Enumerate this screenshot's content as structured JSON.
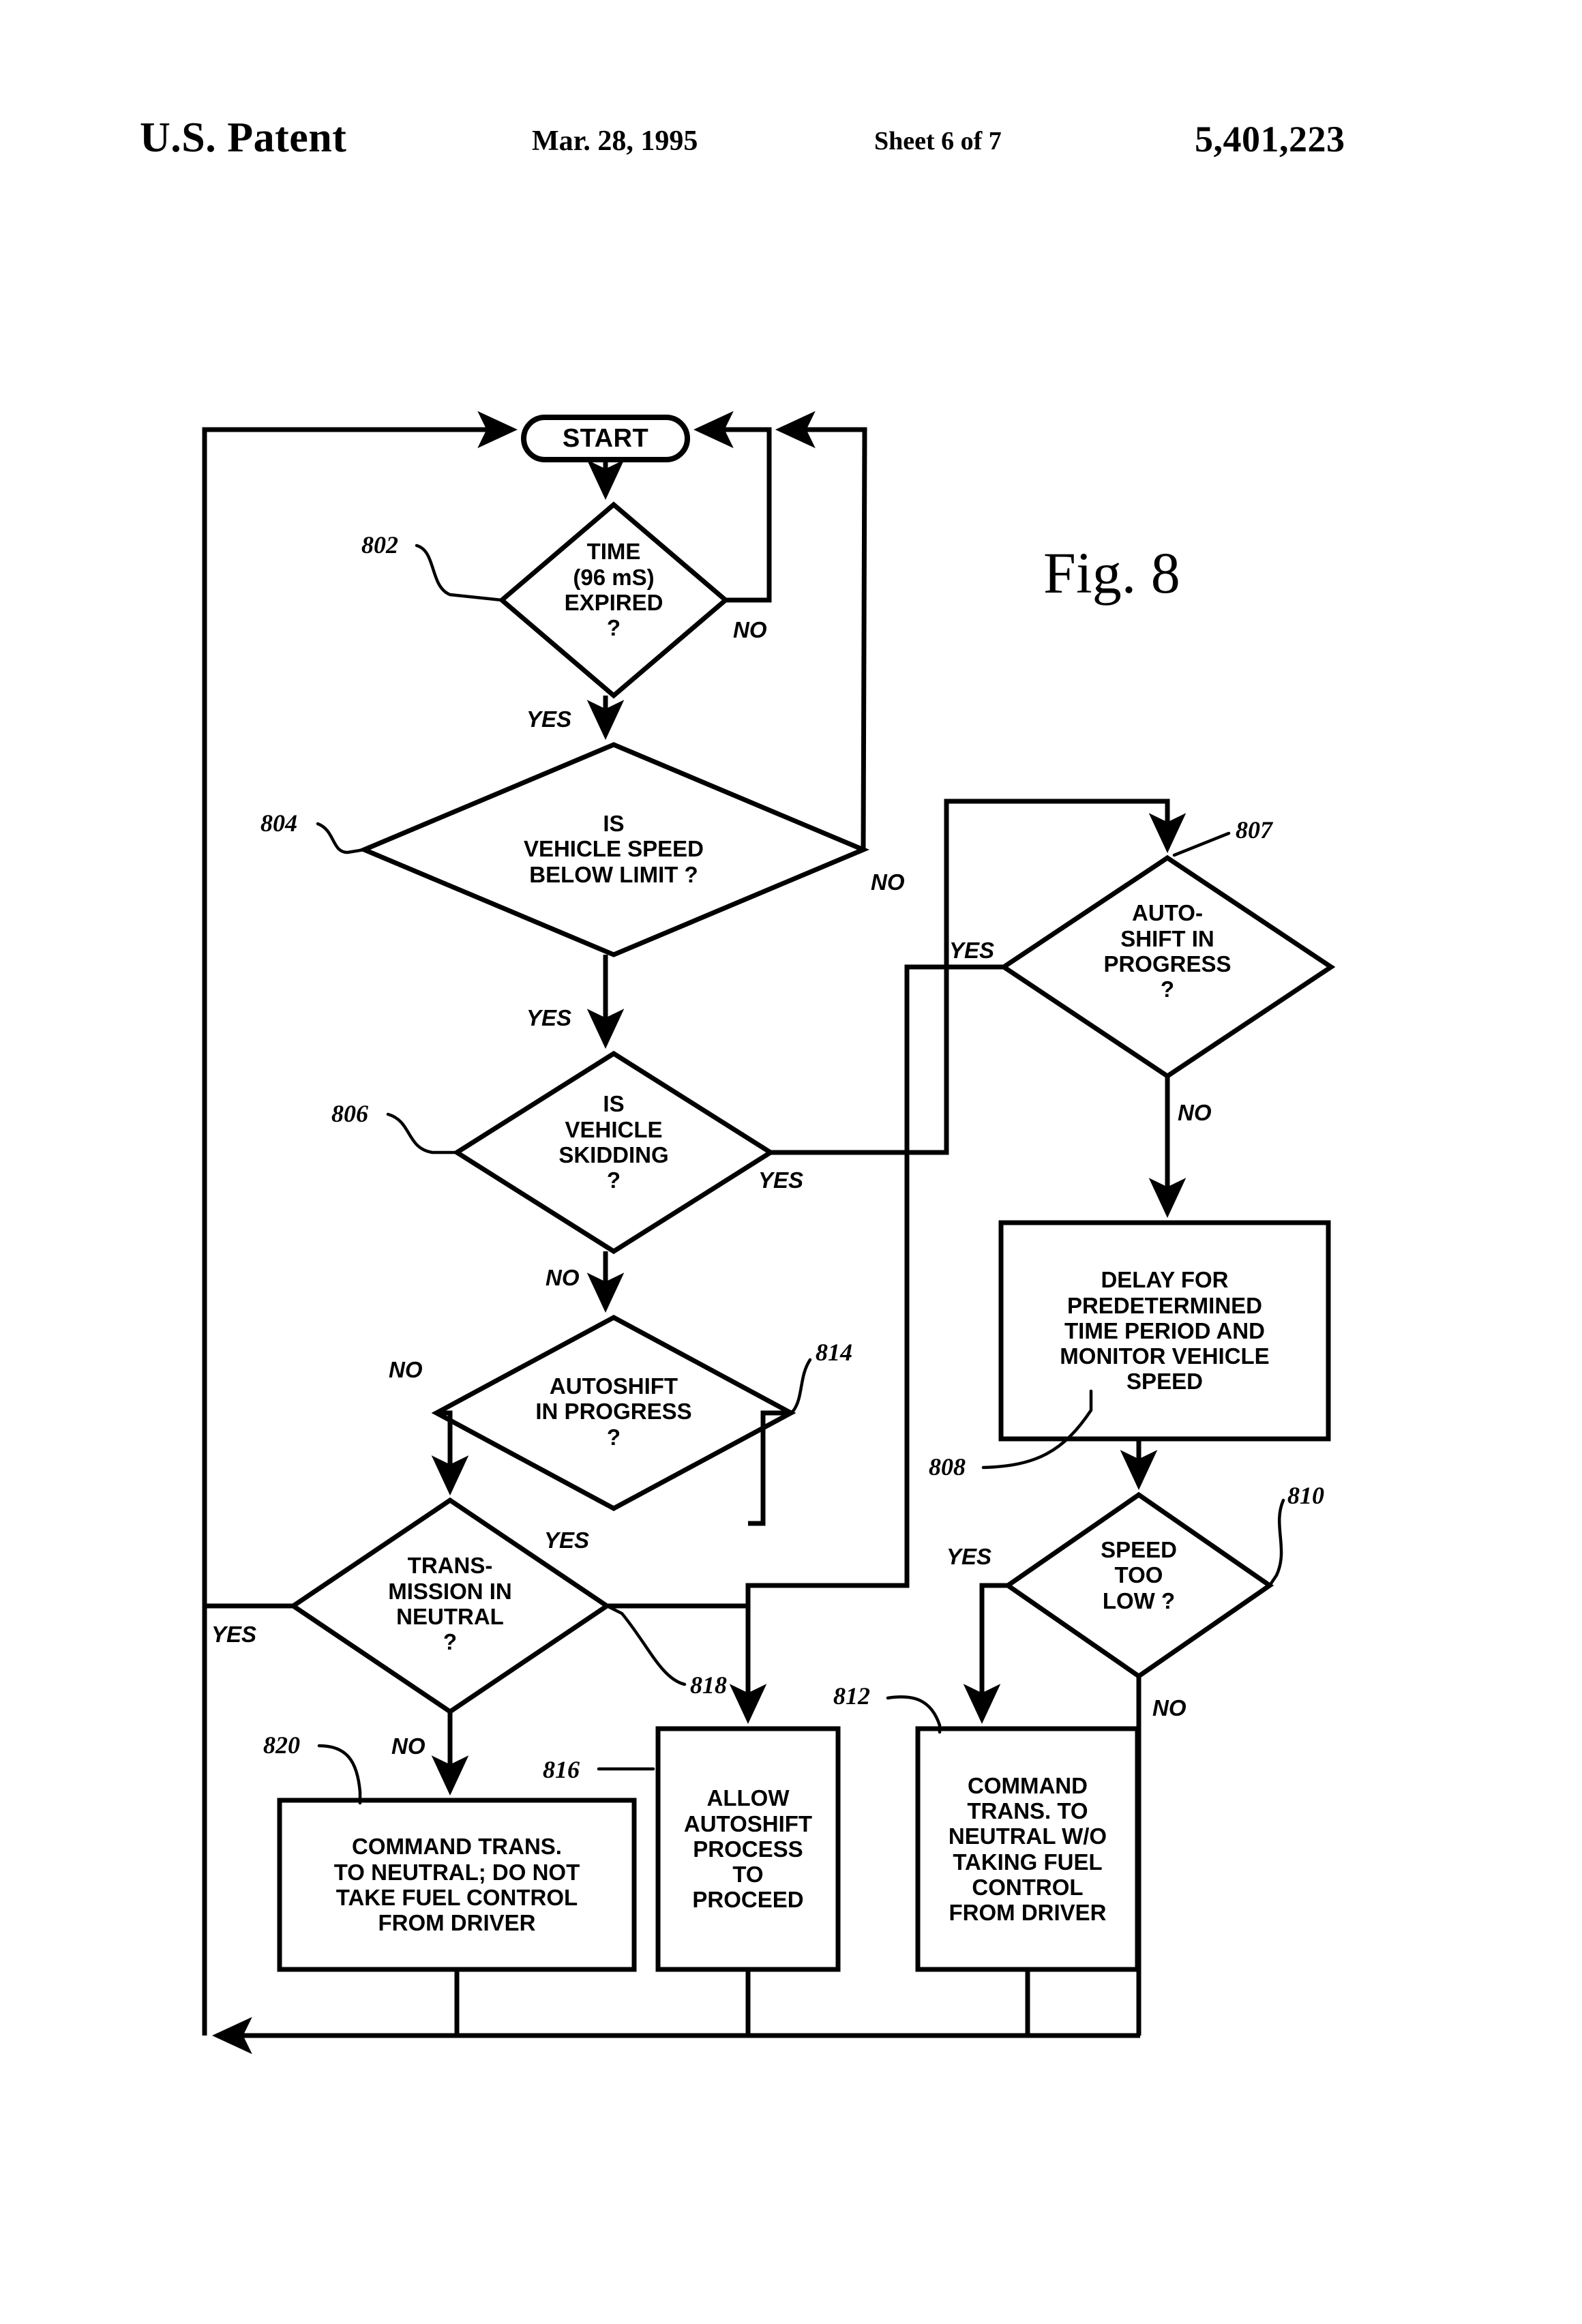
{
  "header": {
    "office": "U.S. Patent",
    "date": "Mar. 28, 1995",
    "sheet": "Sheet 6 of 7",
    "patent_number": "5,401,223"
  },
  "figure": {
    "label": "Fig. 8"
  },
  "nodes": {
    "start": {
      "ref": "",
      "text": "START",
      "shape": "terminator"
    },
    "n802": {
      "ref": "802",
      "text": "TIME\n(96 mS)\nEXPIRED\n?",
      "shape": "decision"
    },
    "n804": {
      "ref": "804",
      "text": "IS\nVEHICLE SPEED\nBELOW LIMIT  ?",
      "shape": "decision"
    },
    "n806": {
      "ref": "806",
      "text": "IS\nVEHICLE\nSKIDDING\n?",
      "shape": "decision"
    },
    "n807": {
      "ref": "807",
      "text": "AUTO-\nSHIFT IN\nPROGRESS\n?",
      "shape": "decision"
    },
    "n808": {
      "ref": "808",
      "text": "DELAY FOR\nPREDETERMINED\nTIME PERIOD AND\nMONITOR VEHICLE\nSPEED",
      "shape": "process"
    },
    "n810": {
      "ref": "810",
      "text": "SPEED\nTOO\nLOW ?",
      "shape": "decision"
    },
    "n812": {
      "ref": "812",
      "text": "COMMAND\nTRANS.  TO\nNEUTRAL W/O\nTAKING FUEL\nCONTROL\nFROM DRIVER",
      "shape": "process"
    },
    "n814": {
      "ref": "814",
      "text": "AUTOSHIFT\nIN PROGRESS\n?",
      "shape": "decision"
    },
    "n816": {
      "ref": "816",
      "text": "ALLOW\nAUTOSHIFT\nPROCESS\nTO\nPROCEED",
      "shape": "process"
    },
    "n818": {
      "ref": "818",
      "text": "TRANS-\nMISSION IN\nNEUTRAL\n?",
      "shape": "decision"
    },
    "n820": {
      "ref": "820",
      "text": "COMMAND TRANS.\nTO NEUTRAL; DO NOT\nTAKE FUEL CONTROL\nFROM DRIVER",
      "shape": "process"
    }
  },
  "edge_labels": {
    "e802_no": "NO",
    "e802_yes": "YES",
    "e804_no": "NO",
    "e804_yes": "YES",
    "e806_yes": "YES",
    "e806_no": "NO",
    "e807_yes": "YES",
    "e807_no": "NO",
    "e810_yes": "YES",
    "e810_no": "NO",
    "e814_no": "NO",
    "e814_yes": "YES",
    "e818_yes": "YES",
    "e818_no": "NO"
  },
  "colors": {
    "ink": "#000000",
    "paper": "#ffffff"
  }
}
